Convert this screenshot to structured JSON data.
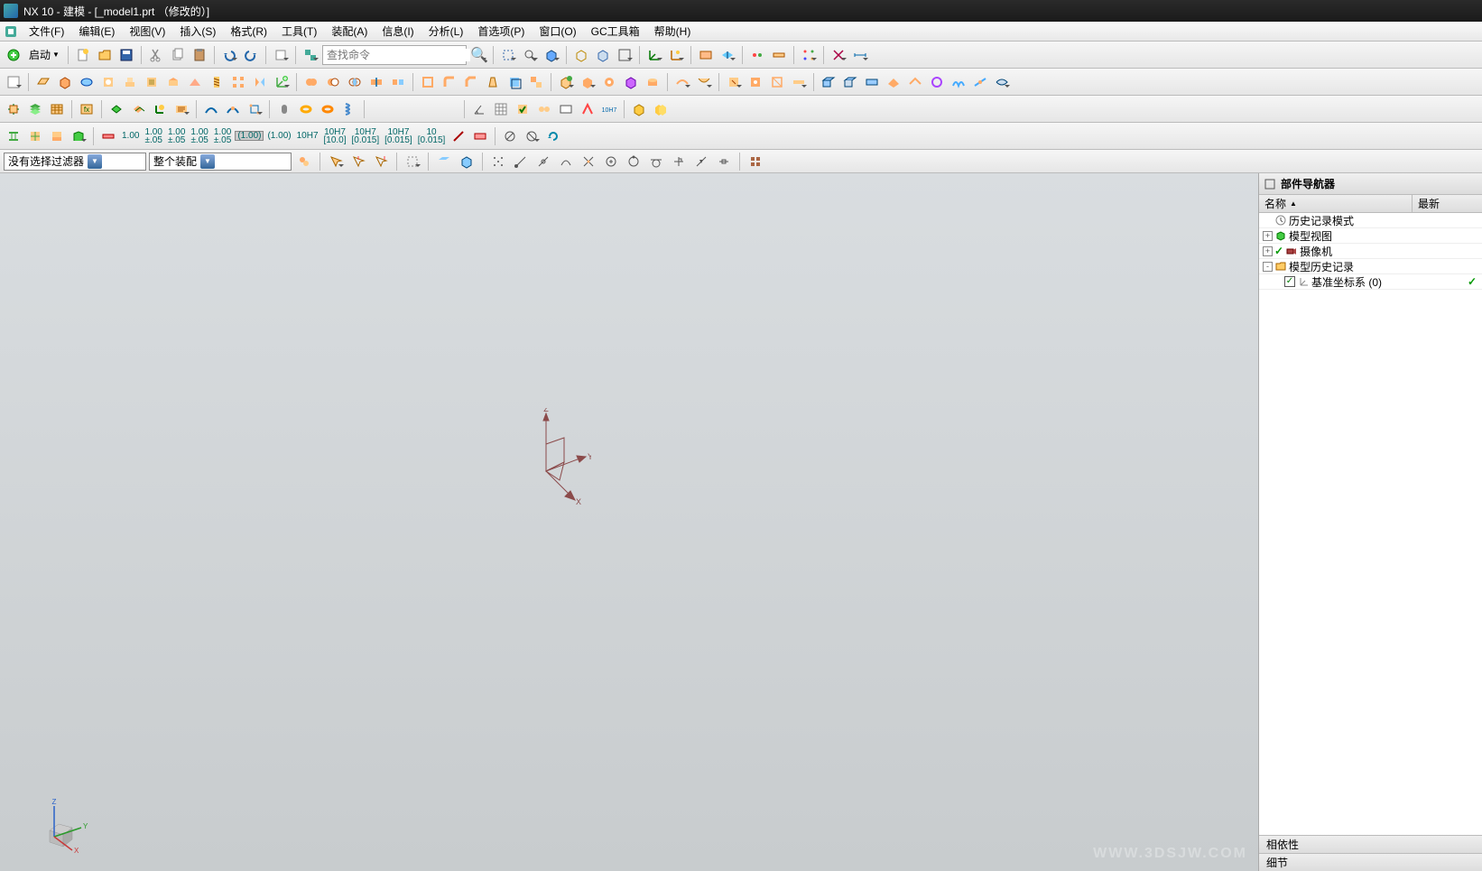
{
  "titlebar": {
    "text": "NX 10 - 建模 - [_model1.prt （修改的）]"
  },
  "menu": {
    "items": [
      "文件(F)",
      "编辑(E)",
      "视图(V)",
      "插入(S)",
      "格式(R)",
      "工具(T)",
      "装配(A)",
      "信息(I)",
      "分析(L)",
      "首选项(P)",
      "窗口(O)",
      "GC工具箱",
      "帮助(H)"
    ]
  },
  "toolbar1": {
    "launch_label": "启动",
    "search_placeholder": "查找命令"
  },
  "tol_labels": [
    "1.00",
    "1.00\n±.05",
    "1.00\n±.05",
    "1.00\n±.05",
    "1.00\n±.05",
    "(1.00)",
    "(1.00)",
    "10H7",
    "10H7\n[10.0]",
    "10H7\n[0.015]",
    "10H7\n[0.015]",
    "10\n[0.015]"
  ],
  "selbar": {
    "filter_label": "没有选择过滤器",
    "scope_label": "整个装配"
  },
  "navigator": {
    "title": "部件导航器",
    "col1": "名称",
    "col2": "最新",
    "nodes": [
      {
        "indent": 0,
        "expander": "",
        "icon": "clock",
        "label": "历史记录模式",
        "check": ""
      },
      {
        "indent": 0,
        "expander": "+",
        "icon": "cube-g",
        "label": "模型视图",
        "check": ""
      },
      {
        "indent": 0,
        "expander": "+",
        "icon": "camera",
        "label": "摄像机",
        "check": "✓"
      },
      {
        "indent": 0,
        "expander": "-",
        "icon": "folder",
        "label": "模型历史记录",
        "check": ""
      },
      {
        "indent": 1,
        "expander": "",
        "icon": "csys",
        "label": "基准坐标系 (0)",
        "check": "✓",
        "checkbox": true
      }
    ],
    "footer1": "相依性",
    "footer2": "细节"
  },
  "axes": {
    "x": "X",
    "y": "Y",
    "z": "Z"
  },
  "watermark": "WWW.3DSJW.COM"
}
